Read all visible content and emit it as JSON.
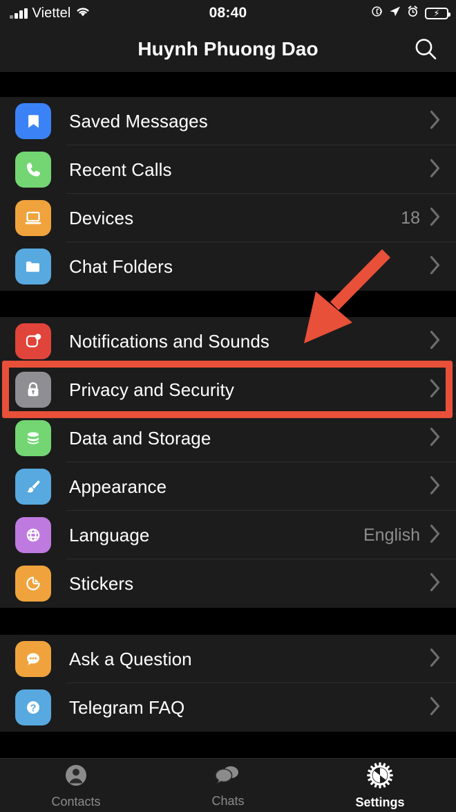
{
  "status_bar": {
    "carrier": "Viettel",
    "time": "08:40",
    "signal_icon": "signal-bars-icon",
    "wifi_icon": "wifi-icon",
    "rotation_lock_icon": "rotation-lock-icon",
    "location_icon": "location-arrow-icon",
    "alarm_icon": "alarm-clock-icon",
    "battery_icon": "battery-charging-icon",
    "battery_color": "#4cd964"
  },
  "header": {
    "title": "Huynh Phuong Dao",
    "search_icon": "search-icon"
  },
  "groups": [
    {
      "rows": [
        {
          "label": "Saved Messages",
          "value": "",
          "icon": "bookmark-icon",
          "color": "#3b82f6"
        },
        {
          "label": "Recent Calls",
          "value": "",
          "icon": "phone-icon",
          "color": "#73d673"
        },
        {
          "label": "Devices",
          "value": "18",
          "icon": "laptop-icon",
          "color": "#f0a33c"
        },
        {
          "label": "Chat Folders",
          "value": "",
          "icon": "folder-icon",
          "color": "#57a9e0"
        }
      ]
    },
    {
      "rows": [
        {
          "label": "Notifications and Sounds",
          "value": "",
          "icon": "notification-bell-icon",
          "color": "#e0443a"
        },
        {
          "label": "Privacy and Security",
          "value": "",
          "icon": "lock-icon",
          "color": "#8e8e93"
        },
        {
          "label": "Data and Storage",
          "value": "",
          "icon": "database-icon",
          "color": "#73d673"
        },
        {
          "label": "Appearance",
          "value": "",
          "icon": "paintbrush-icon",
          "color": "#57a9e0"
        },
        {
          "label": "Language",
          "value": "English",
          "icon": "globe-icon",
          "color": "#bf7ae0"
        },
        {
          "label": "Stickers",
          "value": "",
          "icon": "sticker-icon",
          "color": "#f0a33c"
        }
      ]
    },
    {
      "rows": [
        {
          "label": "Ask a Question",
          "value": "",
          "icon": "chat-bubble-icon",
          "color": "#f0a33c"
        },
        {
          "label": "Telegram FAQ",
          "value": "",
          "icon": "question-mark-icon",
          "color": "#57a9e0"
        }
      ]
    }
  ],
  "tab_bar": {
    "tabs": [
      {
        "label": "Contacts",
        "icon": "contacts-person-icon",
        "active": false
      },
      {
        "label": "Chats",
        "icon": "chats-bubbles-icon",
        "active": false
      },
      {
        "label": "Settings",
        "icon": "settings-gear-icon",
        "active": true
      }
    ]
  },
  "annotations": {
    "highlight_color": "#e8503a",
    "highlight_target": "Privacy and Security",
    "arrow_target": "Privacy and Security"
  }
}
